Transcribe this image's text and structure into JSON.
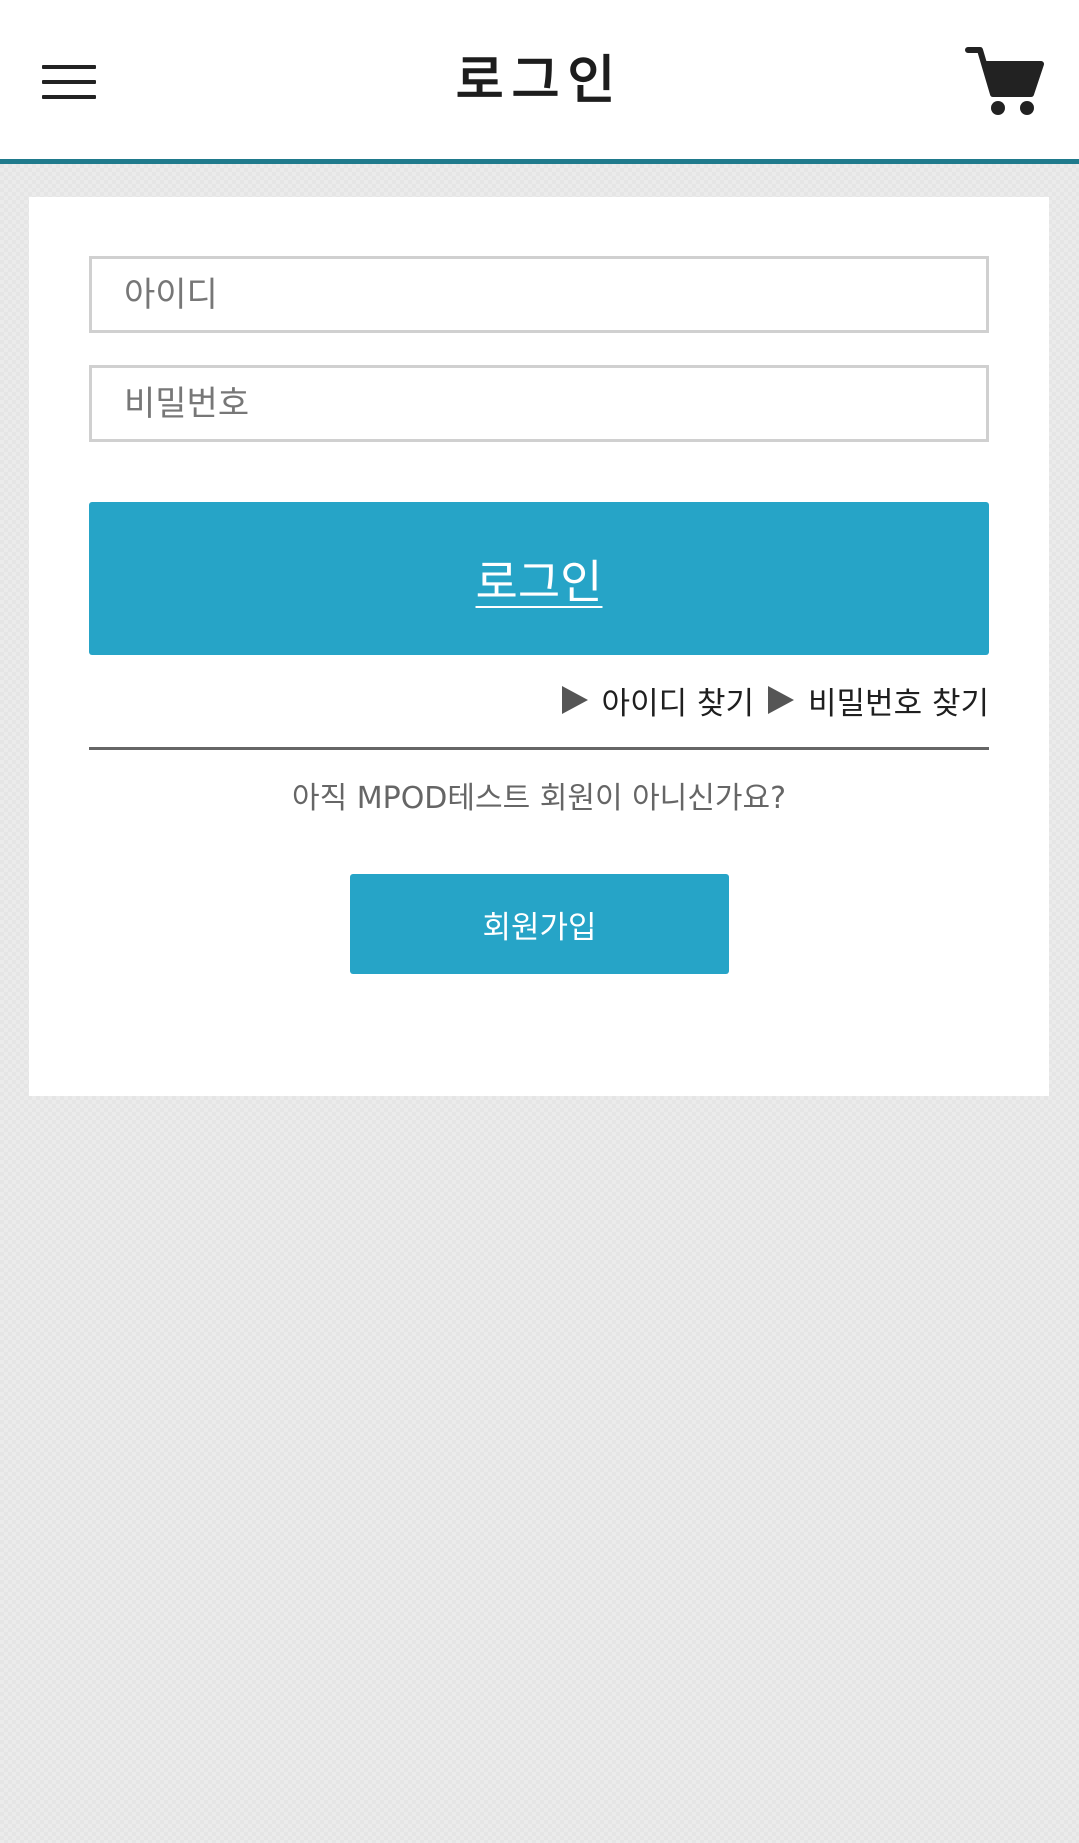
{
  "header": {
    "title": "로그인",
    "menu_icon": "hamburger-menu-icon",
    "cart_icon": "shopping-cart-icon"
  },
  "login_form": {
    "id_placeholder": "아이디",
    "id_value": "",
    "password_placeholder": "비밀번호",
    "password_value": "",
    "login_button_label": "로그인",
    "find_id_label": "아이디 찾기",
    "find_password_label": "비밀번호 찾기"
  },
  "signup": {
    "prompt": "아직 MPOD테스트 회원이 아니신가요?",
    "button_label": "회원가입"
  },
  "colors": {
    "accent": "#26a4c7",
    "header_border": "#1f7a8c",
    "background": "#ebebeb"
  }
}
